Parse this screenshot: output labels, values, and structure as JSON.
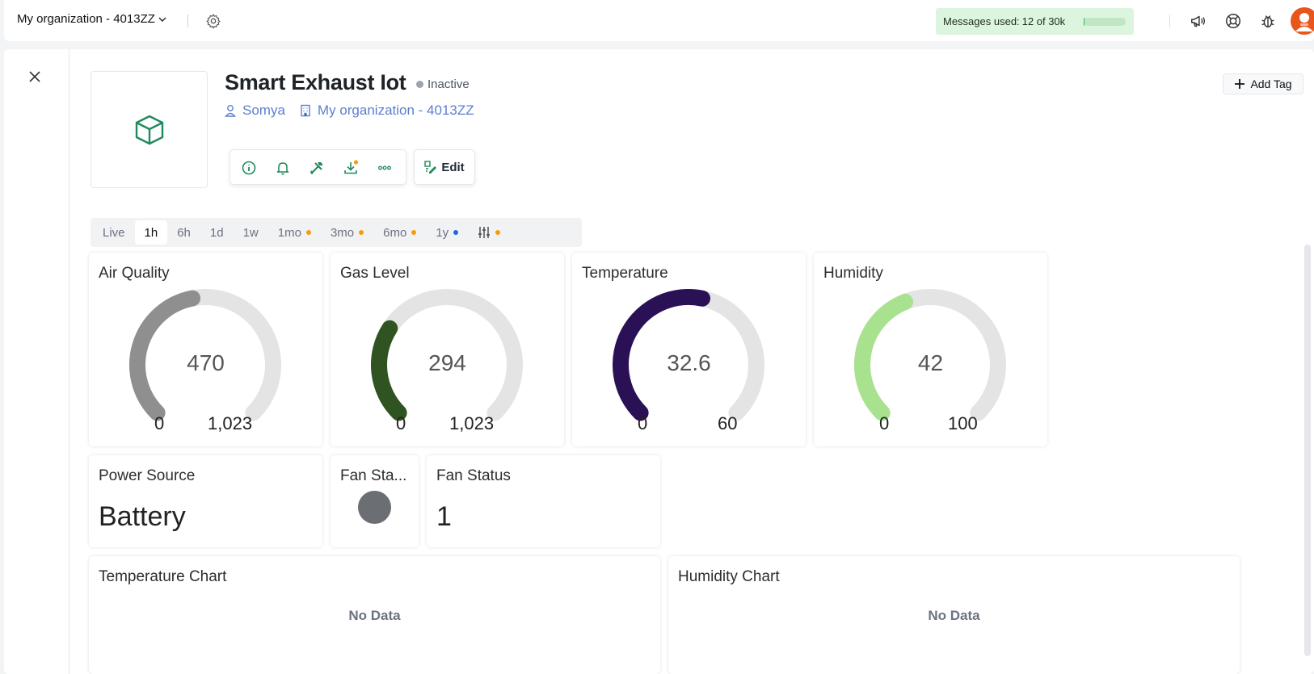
{
  "topbar": {
    "org_label": "My organization - 4013ZZ",
    "messages_label": "Messages used:",
    "messages_value": "12 of 30k",
    "messages_usage_fraction": 0.0004,
    "icons": [
      "settings-gear-icon",
      "megaphone-icon",
      "lifebuoy-icon",
      "bug-icon",
      "user-avatar"
    ]
  },
  "device": {
    "name": "Smart Exhaust Iot",
    "status": "Inactive",
    "owner": "Somya",
    "organization": "My organization - 4013ZZ",
    "add_tag_label": "Add Tag",
    "edit_label": "Edit",
    "actions": [
      "info-icon",
      "bell-icon",
      "tools-icon",
      "download-icon",
      "more-icon"
    ]
  },
  "timerange": {
    "options": [
      {
        "label": "Live",
        "dot": ""
      },
      {
        "label": "1h",
        "dot": "",
        "active": true
      },
      {
        "label": "6h",
        "dot": ""
      },
      {
        "label": "1d",
        "dot": ""
      },
      {
        "label": "1w",
        "dot": ""
      },
      {
        "label": "1mo",
        "dot": "#f59e0b"
      },
      {
        "label": "3mo",
        "dot": "#f59e0b"
      },
      {
        "label": "6mo",
        "dot": "#f59e0b"
      },
      {
        "label": "1y",
        "dot": "#2563eb"
      }
    ],
    "custom_dot": "#f59e0b"
  },
  "gauges": [
    {
      "title": "Air Quality",
      "value": "470",
      "min": "0",
      "max": "1,023",
      "value_num": 470,
      "max_num": 1023,
      "color": "#8f8f8f"
    },
    {
      "title": "Gas Level",
      "value": "294",
      "min": "0",
      "max": "1,023",
      "value_num": 294,
      "max_num": 1023,
      "color": "#2f5321"
    },
    {
      "title": "Temperature",
      "value": "32.6",
      "min": "0",
      "max": "60",
      "value_num": 32.6,
      "max_num": 60,
      "color": "#2a1155"
    },
    {
      "title": "Humidity",
      "value": "42",
      "min": "0",
      "max": "100",
      "value_num": 42,
      "max_num": 100,
      "color": "#a8e28e"
    }
  ],
  "widgets": {
    "power_source": {
      "title": "Power Source",
      "value": "Battery"
    },
    "fan_state": {
      "title": "Fan Sta...",
      "color": "#6b6e73"
    },
    "fan_status": {
      "title": "Fan Status",
      "value": "1"
    }
  },
  "charts": {
    "temperature": {
      "title": "Temperature Chart",
      "empty": "No Data"
    },
    "humidity": {
      "title": "Humidity Chart",
      "empty": "No Data"
    }
  },
  "colors": {
    "brand_green": "#1f8a5b",
    "link_blue": "#5b7fd1",
    "track_gray": "#e4e4e4"
  }
}
